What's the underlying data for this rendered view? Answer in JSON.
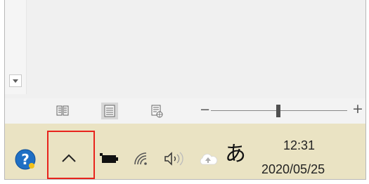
{
  "view_buttons": [
    {
      "name": "read-mode-icon",
      "active": false
    },
    {
      "name": "print-layout-icon",
      "active": true
    },
    {
      "name": "web-layout-icon",
      "active": false
    }
  ],
  "zoom": {
    "minus_label": "−",
    "plus_label": "+",
    "level_fraction": 0.5
  },
  "tray": {
    "help_icon": "help-icon",
    "show_hidden_icons": "chevron-up-icon",
    "icons": [
      "battery-icon",
      "wifi-icon",
      "speaker-icon",
      "onedrive-cloud-icon"
    ],
    "ime_indicator": "あ"
  },
  "clock": {
    "time": "12:31",
    "date": "2020/05/25"
  },
  "colors": {
    "taskbar": "#eae3c3",
    "highlight": "#e8241c",
    "help_blue": "#1f6fc4"
  }
}
